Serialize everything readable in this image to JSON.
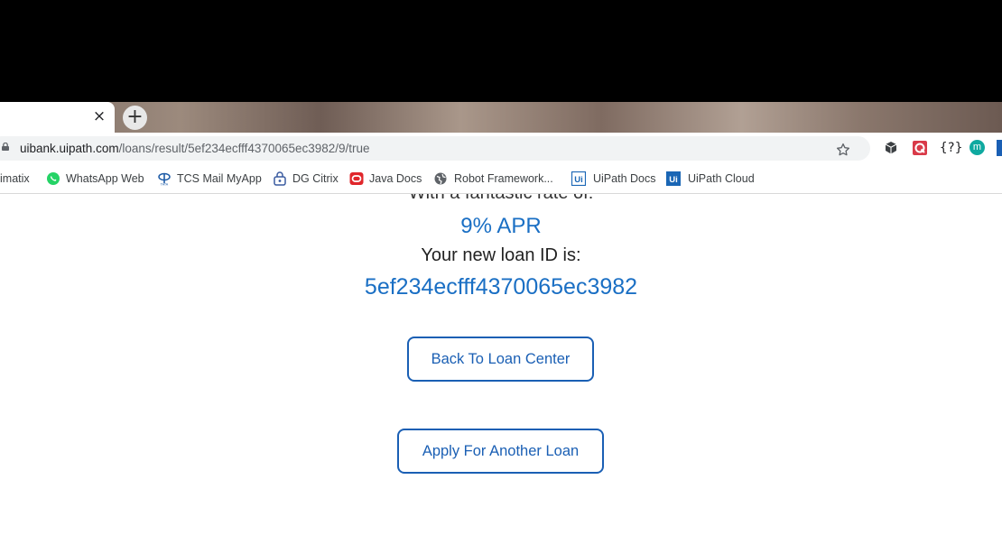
{
  "browser": {
    "tab_close_glyph": "×",
    "new_tab_glyph": "+",
    "url_host": "uibank.uipath.com",
    "url_path": "/loans/result/5ef234ecfff4370065ec3982/9/true",
    "extensions": [
      "cube-extension-icon",
      "recording-extension-icon",
      "json-extension-icon",
      "profile-m-icon",
      "blue-extension-icon"
    ],
    "profile_letter": "m",
    "json_ext_text": "{?}"
  },
  "bookmarks": [
    {
      "label": "imatix",
      "icon": "none"
    },
    {
      "label": "WhatsApp Web",
      "icon": "whatsapp-icon"
    },
    {
      "label": "TCS Mail MyApp",
      "icon": "tata-icon"
    },
    {
      "label": "DG Citrix",
      "icon": "lock-bag-icon"
    },
    {
      "label": "Java Docs",
      "icon": "oracle-icon"
    },
    {
      "label": "Robot Framework...",
      "icon": "globe-icon"
    },
    {
      "label": "UiPath Docs",
      "icon": "uipath-icon"
    },
    {
      "label": "UiPath Cloud",
      "icon": "uipath-icon"
    }
  ],
  "page": {
    "rate_intro": "With a fantastic rate of:",
    "rate": "9% APR",
    "id_label": "Your new loan ID is:",
    "loan_id": "5ef234ecfff4370065ec3982",
    "back_button": "Back To Loan Center",
    "apply_button": "Apply For Another Loan"
  },
  "colors": {
    "accent": "#1a6fc4",
    "button_border": "#1a5fb4"
  }
}
